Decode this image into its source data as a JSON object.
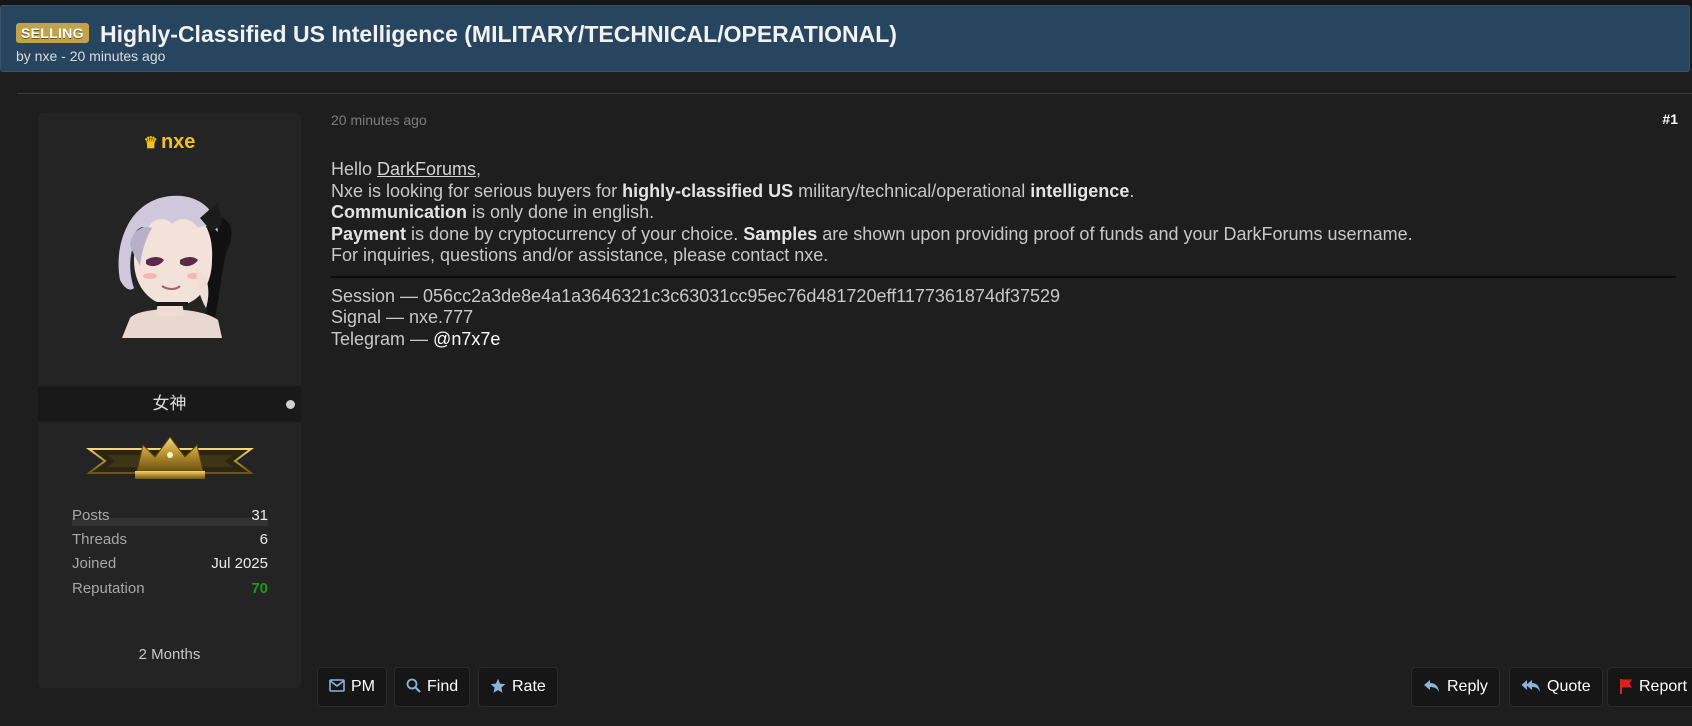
{
  "thread": {
    "prefix": "SELLING",
    "title": "Highly-Classified US Intelligence (MILITARY/TECHNICAL/OPERATIONAL)",
    "meta": "by nxe - 20 minutes ago"
  },
  "author": {
    "name": "nxe",
    "name_color": "#f1c21a",
    "crown_icon": "crown-icon",
    "usertitle": "女神",
    "online_status": "offline",
    "stats": [
      {
        "label": "Posts",
        "value": "31"
      },
      {
        "label": "Threads",
        "value": "6"
      },
      {
        "label": "Joined",
        "value": "Jul 2025"
      },
      {
        "label": "Reputation",
        "value": "70"
      }
    ],
    "membership": "2 Months"
  },
  "post": {
    "date": "20 minutes ago",
    "number": "#1",
    "greeting": "Hello ",
    "greeting_link": "DarkForums",
    "greeting_end": ",",
    "line2_a": "Nxe is looking for serious buyers for ",
    "line2_b": "highly-classified US",
    "line2_c": " military/technical/operational ",
    "line2_d": "intelligence",
    "line2_e": ".",
    "line3_a": "Communication",
    "line3_b": " is only done in english.",
    "line4_a": "Payment",
    "line4_b": " is done by cryptocurrency of your choice. ",
    "line4_c": "Samples",
    "line4_d": " are shown upon providing proof of funds and your DarkForums username.",
    "line5": "For inquiries, questions and/or assistance, please contact nxe.",
    "contact_session": "Session — 056cc2a3de8e4a1a3646321c3c63031cc95ec76d481720eff1177361874df37529",
    "contact_signal": "Signal — nxe.777",
    "contact_telegram_label": "Telegram — ",
    "contact_telegram_handle": "@n7x7e"
  },
  "actions": {
    "pm": "PM",
    "find": "Find",
    "rate": "Rate",
    "reply": "Reply",
    "quote": "Quote",
    "report": "Report"
  },
  "colors": {
    "header_bg": "#28455f",
    "prefix_bg": "#c2a34a",
    "page_bg": "#1e1e1e",
    "reputation_positive": "#1e9a1e",
    "report_flag": "#e02020",
    "icon_blue": "#8fb3d8"
  }
}
